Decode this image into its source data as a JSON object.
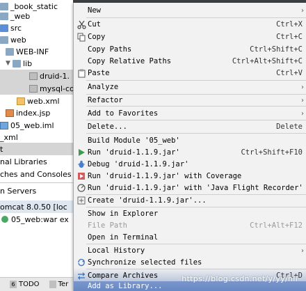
{
  "project_tree": {
    "rows": [
      {
        "label": "_book_static",
        "icon": "module-folder-icon"
      },
      {
        "label": "_web",
        "icon": "module-folder-icon"
      },
      {
        "label": "src",
        "icon": "source-folder-icon"
      },
      {
        "label": "web",
        "icon": "web-folder-icon"
      },
      {
        "label": "WEB-INF",
        "icon": "folder-icon"
      },
      {
        "label": "lib",
        "icon": "folder-icon"
      },
      {
        "label": "druid-1.",
        "icon": "jar-icon"
      },
      {
        "label": "mysql-co",
        "icon": "jar-icon"
      },
      {
        "label": "web.xml",
        "icon": "xml-file-icon"
      },
      {
        "label": "index.jsp",
        "icon": "jsp-file-icon"
      },
      {
        "label": "05_web.iml",
        "icon": "iml-file-icon"
      },
      {
        "label": "_xml",
        "icon": ""
      },
      {
        "label": "t",
        "icon": ""
      },
      {
        "label": "nal Libraries",
        "icon": ""
      },
      {
        "label": "ches and Consoles",
        "icon": ""
      }
    ],
    "services_header": "n Servers",
    "tomcat_row": "omcat 8.0.50 [loc",
    "deploy_row": "05_web:war ex"
  },
  "status_bar": {
    "todo_num": "6",
    "todo_label": "TODO",
    "terminal_label": "Ter"
  },
  "watermark": "https://blog.csdn.net/y/yy/nil",
  "context_menu": {
    "new": {
      "label": "New"
    },
    "cut": {
      "label": "Cut",
      "shortcut": "Ctrl+X"
    },
    "copy": {
      "label": "Copy",
      "shortcut": "Ctrl+C"
    },
    "copy_paths": {
      "label": "Copy Paths",
      "shortcut": "Ctrl+Shift+C"
    },
    "copy_relative_paths": {
      "label": "Copy Relative Paths",
      "shortcut": "Ctrl+Alt+Shift+C"
    },
    "paste": {
      "label": "Paste",
      "shortcut": "Ctrl+V"
    },
    "analyze": {
      "label": "Analyze"
    },
    "refactor": {
      "label": "Refactor"
    },
    "add_to_favorites": {
      "label": "Add to Favorites"
    },
    "delete": {
      "label": "Delete...",
      "shortcut": "Delete"
    },
    "build_module": {
      "label": "Build Module '05_web'"
    },
    "run": {
      "label": "Run 'druid-1.1.9.jar'",
      "shortcut": "Ctrl+Shift+F10"
    },
    "debug": {
      "label": "Debug 'druid-1.1.9.jar'"
    },
    "run_coverage": {
      "label": "Run 'druid-1.1.9.jar' with Coverage"
    },
    "run_jfr": {
      "label": "Run 'druid-1.1.9.jar' with 'Java Flight Recorder'"
    },
    "create": {
      "label": "Create 'druid-1.1.9.jar'..."
    },
    "show_in_explorer": {
      "label": "Show in Explorer"
    },
    "file_path": {
      "label": "File Path",
      "shortcut": "Ctrl+Alt+F12"
    },
    "open_in_terminal": {
      "label": "Open in Terminal"
    },
    "local_history": {
      "label": "Local History"
    },
    "synchronize": {
      "label": "Synchronize selected files"
    },
    "compare_archives": {
      "label": "Compare Archives",
      "shortcut": "Ctrl+D"
    },
    "add_as_library": {
      "label": "Add as Library..."
    }
  },
  "colors": {
    "menu_background": "#f2f2f2",
    "highlight": "#3875d7",
    "run_icon": "#3e9b4f",
    "debug_icon": "#4a7fc9"
  }
}
